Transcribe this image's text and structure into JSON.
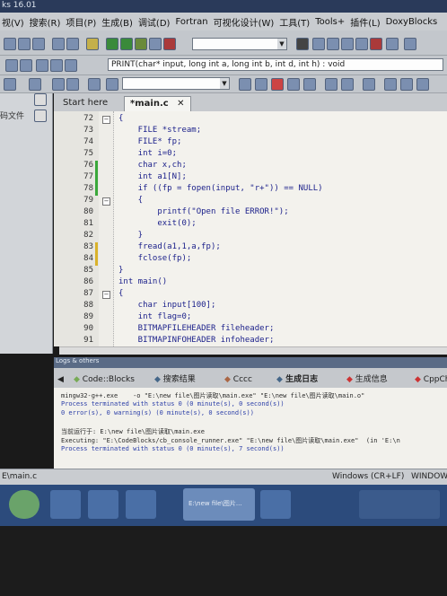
{
  "window": {
    "title": "ks 16.01"
  },
  "menu": [
    "视(V)",
    "搜索(R)",
    "项目(P)",
    "生成(B)",
    "调试(D)",
    "Fortran",
    "可视化设计(W)",
    "工具(T)",
    "Tools+",
    "插件(L)",
    "DoxyBlocks"
  ],
  "toolbar": {
    "function_combo": "PRINT(char* input, long int a, long int b, int d, int h) : void"
  },
  "left_panel": {
    "label": "码文件"
  },
  "editor": {
    "tabs": [
      "Start here",
      "*main.c"
    ],
    "lines": [
      {
        "n": "72",
        "t": "{"
      },
      {
        "n": "73",
        "t": "    FILE *stream;"
      },
      {
        "n": "74",
        "t": "    FILE* fp;"
      },
      {
        "n": "75",
        "t": "    int i=0;"
      },
      {
        "n": "76",
        "t": "    char x,ch;"
      },
      {
        "n": "77",
        "t": "    int a1[N];"
      },
      {
        "n": "78",
        "t": "    if ((fp = fopen(input, \"r+\")) == NULL)"
      },
      {
        "n": "79",
        "t": "    {"
      },
      {
        "n": "80",
        "t": "        printf(\"Open file ERROR!\");"
      },
      {
        "n": "81",
        "t": "        exit(0);"
      },
      {
        "n": "82",
        "t": "    }"
      },
      {
        "n": "83",
        "t": "    fread(a1,1,a,fp);"
      },
      {
        "n": "84",
        "t": "    fclose(fp);"
      },
      {
        "n": "85",
        "t": "}"
      },
      {
        "n": "86",
        "t": "int main()"
      },
      {
        "n": "87",
        "t": "{"
      },
      {
        "n": "88",
        "t": "    char input[100];"
      },
      {
        "n": "89",
        "t": "    int flag=0;"
      },
      {
        "n": "90",
        "t": "    BITMAPFILEHEADER fileheader;"
      },
      {
        "n": "91",
        "t": "    BITMAPINFOHEADER infoheader;"
      }
    ]
  },
  "logs": {
    "title": "Logs & others",
    "tabs": [
      "Code::Blocks",
      "搜索结果",
      "Cccc",
      "生成日志",
      "生成信息",
      "CppCh"
    ],
    "lines": [
      "mingw32-g++.exe    -o \"E:\\new file\\图片读取\\main.exe\" \"E:\\new file\\图片读取\\main.o\"",
      "Process terminated with status 0 (0 minute(s), 0 second(s))",
      "0 error(s), 0 warning(s) (0 minute(s), 0 second(s))",
      "",
      "当前运行于: E:\\new file\\图片读取\\main.exe",
      "Executing: \"E:\\CodeBlocks/cb_console_runner.exe\" \"E:\\new file\\图片读取\\main.exe\"  (in 'E:\\n",
      "Process terminated with status 0 (0 minute(s), 7 second(s))"
    ]
  },
  "status": {
    "file": "E\\main.c",
    "eol": "Windows (CR+LF)",
    "enc": "WINDOW"
  },
  "taskbar": {
    "active_label": "E:\\new file\\图片..."
  }
}
